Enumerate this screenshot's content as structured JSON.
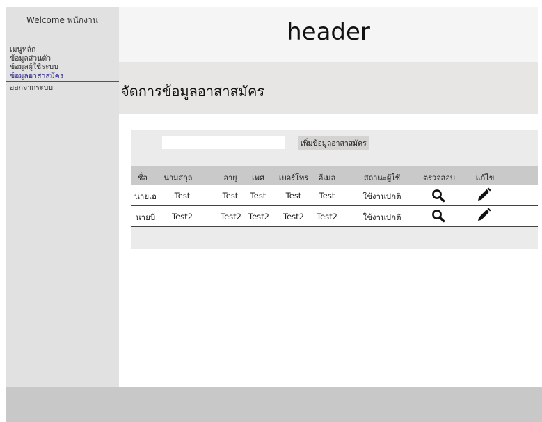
{
  "sidebar": {
    "welcome": "Welcome พนักงาน",
    "items": [
      {
        "label": "เมนูหลัก"
      },
      {
        "label": "ข้อมูลส่วนตัว"
      },
      {
        "label": "ข้อมูลผู้ใช้ระบบ"
      },
      {
        "label": "ข้อมูลอาสาสมัคร"
      },
      {
        "label": "ออกจากระบบ"
      }
    ],
    "active_index": 3
  },
  "header": {
    "title": "header"
  },
  "page": {
    "title": "จัดการข้อมูลอาสาสมัคร"
  },
  "toolbar": {
    "search_value": "",
    "add_label": "เพิ่มข้อมูลอาสาสมัคร"
  },
  "table": {
    "columns": [
      "ชื่อ",
      "นามสกุล",
      "อายุ",
      "เพศ",
      "เบอร์โทร",
      "อีเมล",
      "สถานะผู้ใช้",
      "ตรวจสอบ",
      "แก้ไข"
    ],
    "rows": [
      {
        "name": "นายเอ",
        "surname": "Test",
        "age": "Test",
        "gender": "Test",
        "phone": "Test",
        "email": "Test",
        "status": "ใช้งานปกติ",
        "inspect_icon": "search-icon",
        "edit_icon": "pencil-icon"
      },
      {
        "name": "นายบี",
        "surname": "Test2",
        "age": "Test2",
        "gender": "Test2",
        "phone": "Test2",
        "email": "Test2",
        "status": "ใช้งานปกติ",
        "inspect_icon": "search-icon",
        "edit_icon": "pencil-icon"
      }
    ]
  },
  "colors": {
    "sidebar_bg": "#e1e1e1",
    "active_menu": "#2f2b8f",
    "footer_bg": "#c8c8c8"
  }
}
